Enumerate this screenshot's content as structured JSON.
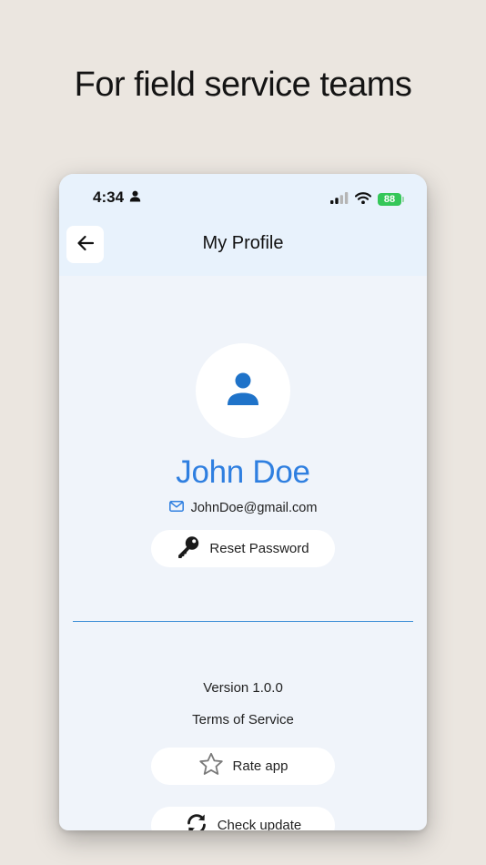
{
  "headline": "For field service teams",
  "status_bar": {
    "time": "4:34",
    "battery": "88"
  },
  "header": {
    "title": "My Profile"
  },
  "profile": {
    "name": "John Doe",
    "email": "JohnDoe@gmail.com"
  },
  "actions": {
    "reset_password": "Reset Password",
    "rate_app": "Rate app",
    "check_update": "Check update"
  },
  "footer": {
    "version": "Version 1.0.0",
    "terms": "Terms of Service"
  },
  "colors": {
    "accent": "#2f7fe0",
    "divider": "#3d8fd6",
    "battery": "#35c759",
    "header_bg": "#e8f2fc",
    "page_bg": "#f0f4fa",
    "background": "#ebe6e0"
  },
  "icons": [
    "user-icon",
    "signal-icon",
    "wifi-icon",
    "battery-icon",
    "arrow-left-icon",
    "avatar-person-icon",
    "mail-icon",
    "key-icon",
    "star-icon",
    "refresh-icon"
  ]
}
